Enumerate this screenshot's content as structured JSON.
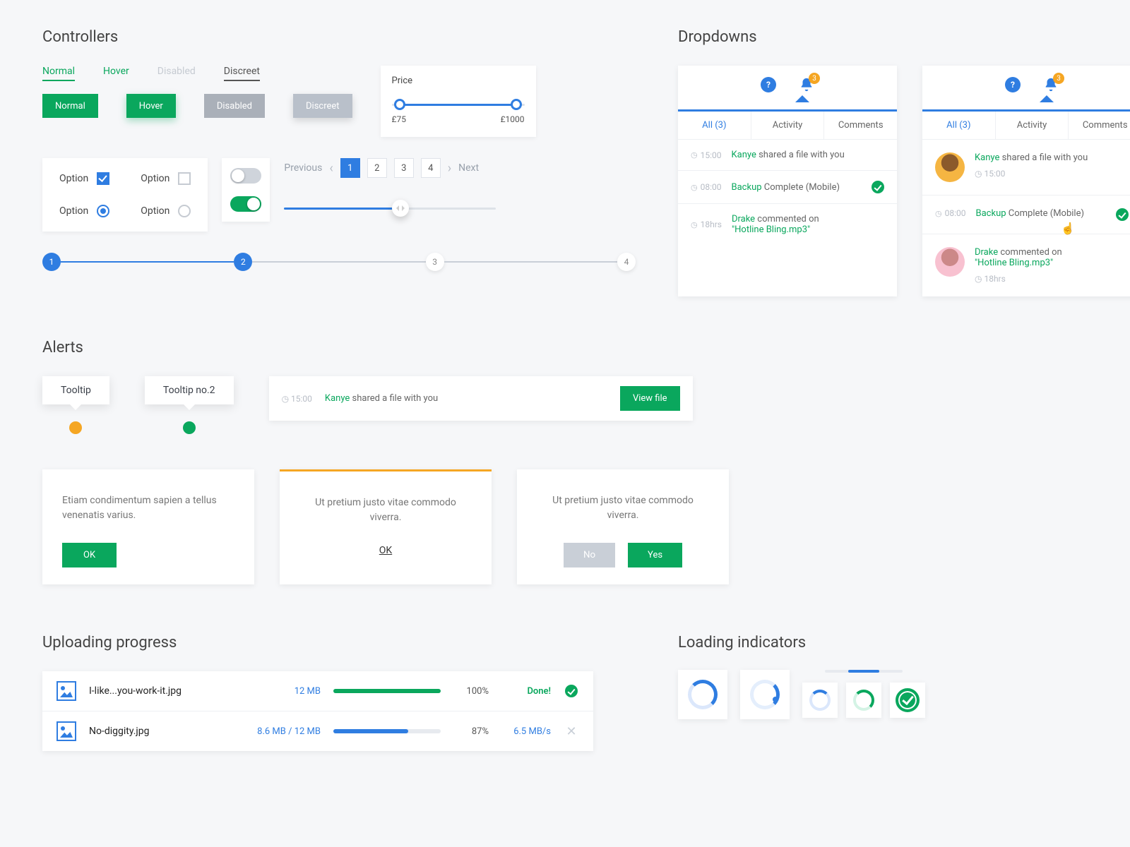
{
  "sections": {
    "controllers": "Controllers",
    "dropdowns": "Dropdowns",
    "alerts": "Alerts",
    "uploading": "Uploading progress",
    "loading": "Loading indicators"
  },
  "tabs": {
    "normal": "Normal",
    "hover": "Hover",
    "disabled": "Disabled",
    "discreet": "Discreet"
  },
  "buttons": {
    "normal": "Normal",
    "hover": "Hover",
    "disabled": "Disabled",
    "discreet": "Discreet"
  },
  "price": {
    "title": "Price",
    "min": "£75",
    "max": "£1000"
  },
  "options": {
    "label": "Option"
  },
  "pager": {
    "prev": "Previous",
    "next": "Next",
    "pages": [
      "1",
      "2",
      "3",
      "4"
    ]
  },
  "steps": [
    "1",
    "2",
    "3",
    "4"
  ],
  "dropdown": {
    "badge": "3",
    "tabs": {
      "all": "All (3)",
      "activity": "Activity",
      "comments": "Comments"
    },
    "items": [
      {
        "time": "15:00",
        "who": "Kanye",
        "text": " shared a file with you"
      },
      {
        "time": "08:00",
        "who": "Backup",
        "text": " Complete (Mobile)"
      },
      {
        "time": "18hrs",
        "who": "Drake",
        "text": " commented on ",
        "quote": "\"Hotline Bling.mp3\""
      }
    ]
  },
  "alerts": {
    "tooltip1": "Tooltip",
    "tooltip2": "Tooltip no.2",
    "toast": {
      "time": "15:00",
      "who": "Kanye",
      "text": " shared a file with you",
      "cta": "View file"
    },
    "card1": {
      "text": "Etiam condimentum sapien a tellus venenatis varius.",
      "ok": "OK"
    },
    "card2": {
      "text": "Ut pretium justo vitae commodo viverra.",
      "ok": "OK"
    },
    "card3": {
      "text": "Ut pretium justo vitae commodo viverra.",
      "no": "No",
      "yes": "Yes"
    }
  },
  "uploads": [
    {
      "name": "I-like...you-work-it.jpg",
      "size": "12 MB",
      "pct": "100%",
      "meta": "Done!",
      "bar": 100,
      "done": true
    },
    {
      "name": "No-diggity.jpg",
      "size": "8.6 MB / 12 MB",
      "pct": "87%",
      "meta": "6.5 MB/s",
      "bar": 70,
      "done": false
    }
  ]
}
